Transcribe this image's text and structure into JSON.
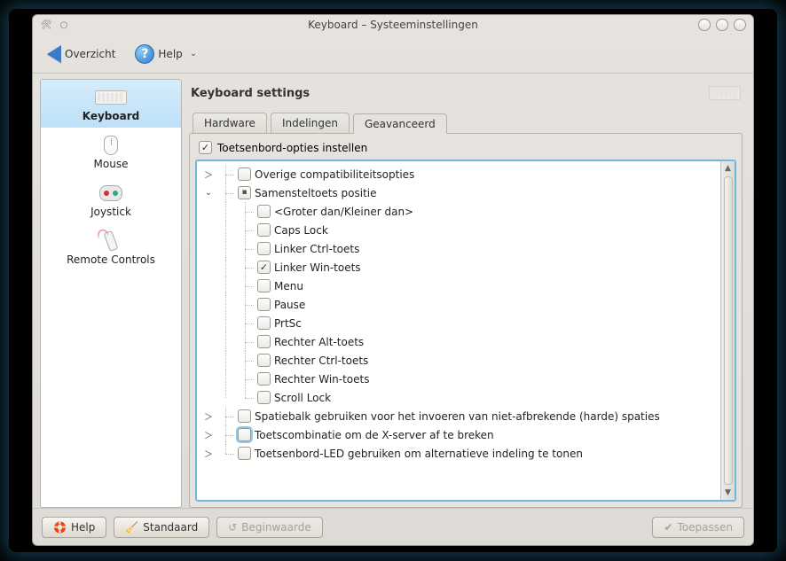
{
  "window": {
    "title": "Keyboard – Systeeminstellingen"
  },
  "toolbar": {
    "overview": "Overzicht",
    "help": "Help"
  },
  "sidebar": {
    "items": [
      {
        "label": "Keyboard"
      },
      {
        "label": "Mouse"
      },
      {
        "label": "Joystick"
      },
      {
        "label": "Remote Controls"
      }
    ]
  },
  "main": {
    "title": "Keyboard settings",
    "tabs": [
      {
        "label": "Hardware"
      },
      {
        "label": "Indelingen"
      },
      {
        "label": "Geavanceerd"
      }
    ],
    "enable_options_label": "Toetsenbord-opties instellen",
    "tree": {
      "n0": "Overige compatibiliteitsopties",
      "n1": "Samensteltoets positie",
      "c0": "<Groter dan/Kleiner dan>",
      "c1": "Caps Lock",
      "c2": "Linker Ctrl-toets",
      "c3": "Linker Win-toets",
      "c4": "Menu",
      "c5": "Pause",
      "c6": "PrtSc",
      "c7": "Rechter Alt-toets",
      "c8": "Rechter Ctrl-toets",
      "c9": "Rechter Win-toets",
      "c10": "Scroll Lock",
      "n2": "Spatiebalk gebruiken voor het invoeren van niet-afbrekende (harde) spaties",
      "n3": "Toetscombinatie om de X-server af te breken",
      "n4": "Toetsenbord-LED gebruiken om alternatieve indeling te tonen"
    }
  },
  "footer": {
    "help": "Help",
    "reset": "Standaard",
    "revert": "Beginwaarde",
    "apply": "Toepassen"
  }
}
